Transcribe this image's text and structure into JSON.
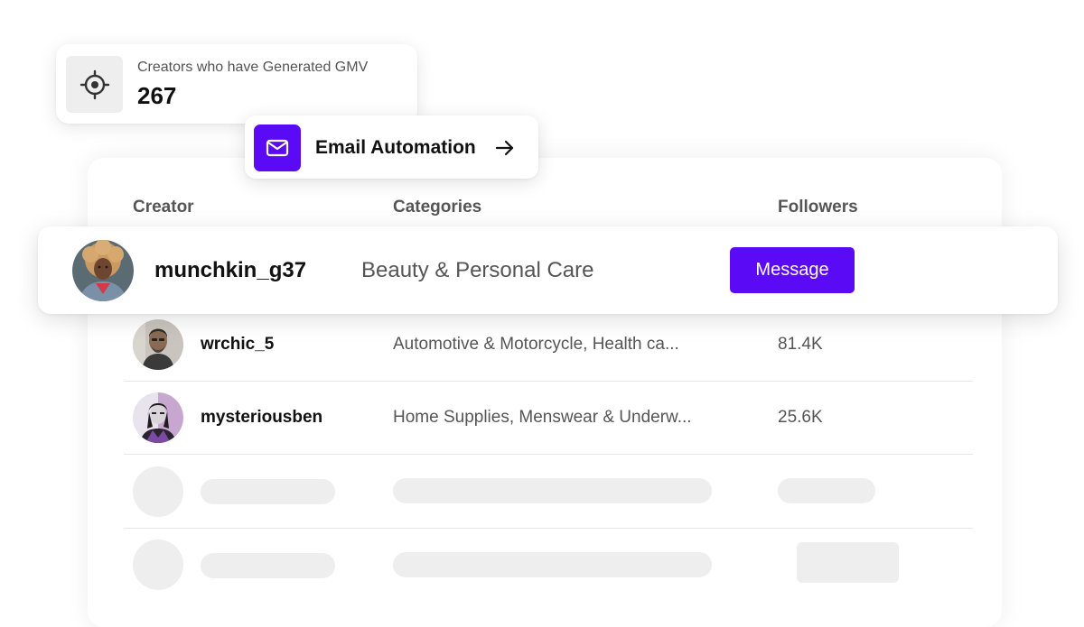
{
  "stat_card": {
    "icon": "crosshair-icon",
    "label": "Creators who have Generated GMV",
    "value": "267"
  },
  "email_automation": {
    "icon": "mail-icon",
    "label": "Email Automation",
    "arrow_icon": "arrow-right-icon"
  },
  "table": {
    "columns": [
      "Creator",
      "Categories",
      "Followers"
    ],
    "highlighted_row": {
      "handle": "munchkin_g37",
      "category": "Beauty & Personal Care",
      "action_label": "Message"
    },
    "rows": [
      {
        "handle": "wrchic_5",
        "category": "Automotive & Motorcycle, Health ca...",
        "followers": "81.4K"
      },
      {
        "handle": "mysteriousben",
        "category": "Home Supplies, Menswear & Underw...",
        "followers": "25.6K"
      }
    ]
  },
  "colors": {
    "accent": "#5b0af5",
    "muted_text": "#555555",
    "skeleton": "#eeeeee"
  }
}
